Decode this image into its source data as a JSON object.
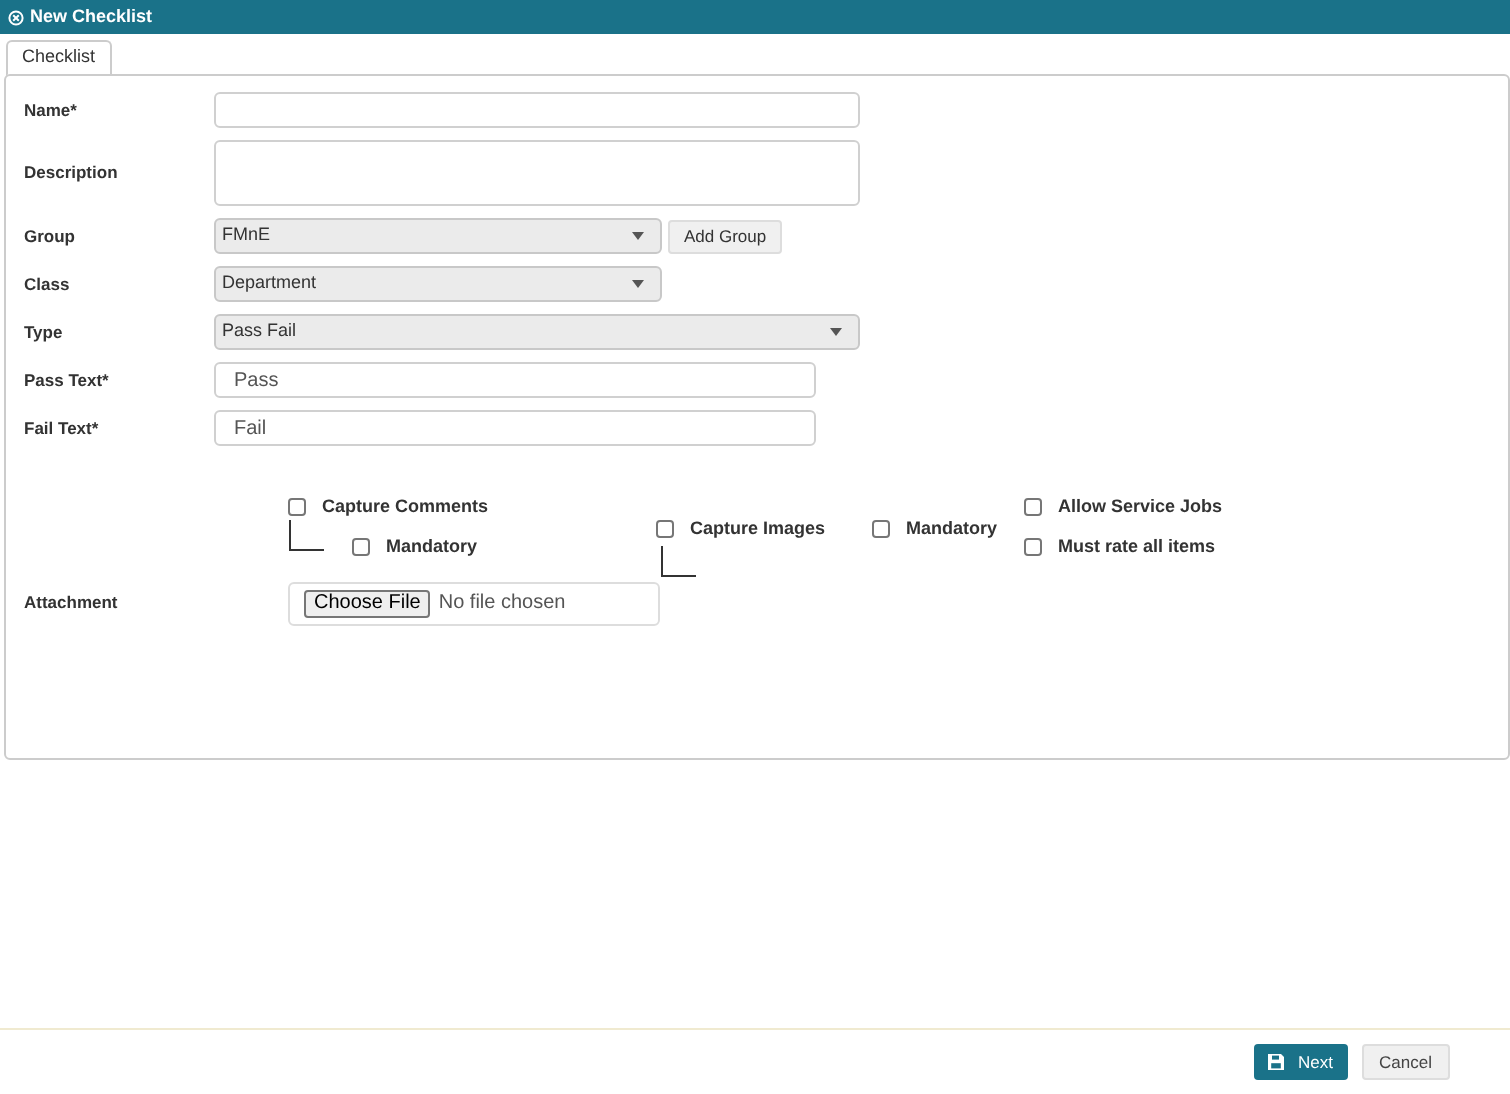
{
  "window": {
    "title": "New Checklist"
  },
  "tabs": [
    {
      "label": "Checklist",
      "selected": true
    }
  ],
  "fields": [
    {
      "kind": "text",
      "label": "Name*"
    },
    {
      "kind": "textarea",
      "label": "Description"
    },
    {
      "kind": "select",
      "label": "Group",
      "value": "FMnE",
      "button": "Add Group"
    },
    {
      "kind": "select",
      "label": "Class",
      "value": "Department"
    },
    {
      "kind": "select",
      "label": "Type",
      "value": "Pass Fail"
    },
    {
      "kind": "text",
      "label": "Pass Text*",
      "value": "Pass"
    },
    {
      "kind": "text",
      "label": "Fail Text*",
      "value": "Fail"
    }
  ],
  "options": {
    "capture_comments": {
      "label": "Capture Comments",
      "checked": false
    },
    "comments_mandatory": {
      "label": "Mandatory",
      "checked": false
    },
    "capture_images": {
      "label": "Capture Images",
      "checked": false
    },
    "images_mandatory": {
      "label": "Mandatory",
      "checked": false
    },
    "allow_service_jobs": {
      "label": "Allow Service Jobs",
      "checked": false
    },
    "must_rate_all": {
      "label": "Must rate all items",
      "checked": false
    }
  },
  "attachment": {
    "label": "Attachment",
    "button": "Choose File",
    "status": "No file chosen"
  },
  "footer": {
    "primary": "Next",
    "secondary": "Cancel"
  }
}
